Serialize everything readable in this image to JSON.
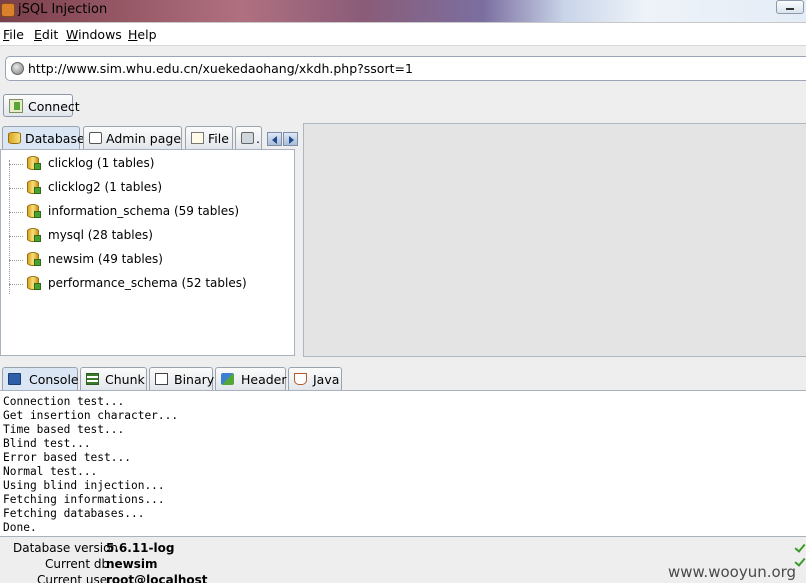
{
  "window": {
    "title": "jSQL Injection"
  },
  "menu": [
    {
      "mnemonic": "F",
      "rest": "ile"
    },
    {
      "mnemonic": "E",
      "rest": "dit"
    },
    {
      "mnemonic": "W",
      "rest": "indows"
    },
    {
      "mnemonic": "H",
      "rest": "elp"
    }
  ],
  "url": {
    "value": "http://www.sim.whu.edu.cn/xuekedaohang/xkdh.php?ssort=1"
  },
  "toolbar": {
    "connect_label": "Connect"
  },
  "left_tabs": [
    {
      "label": "Database",
      "icon": "database-icon",
      "active": true
    },
    {
      "label": "Admin page",
      "icon": "admin-page-icon",
      "active": false
    },
    {
      "label": "File",
      "icon": "file-icon",
      "active": false
    },
    {
      "label": ".",
      "icon": "webshell-icon",
      "active": false
    }
  ],
  "databases": [
    {
      "label": "clicklog (1 tables)"
    },
    {
      "label": "clicklog2 (1 tables)"
    },
    {
      "label": "information_schema (59 tables)"
    },
    {
      "label": "mysql (28 tables)"
    },
    {
      "label": "newsim (49 tables)"
    },
    {
      "label": "performance_schema (52 tables)"
    }
  ],
  "bottom_tabs": [
    {
      "label": "Console",
      "icon": "console-icon",
      "active": true
    },
    {
      "label": "Chunk",
      "icon": "chunk-icon",
      "active": false
    },
    {
      "label": "Binary",
      "icon": "binary-icon",
      "active": false
    },
    {
      "label": "Header",
      "icon": "header-icon",
      "active": false
    },
    {
      "label": "Java",
      "icon": "java-icon",
      "active": false
    }
  ],
  "console": [
    "Connection test...",
    "Get insertion character...",
    "Time based test...",
    "Blind test...",
    "Error based test...",
    "Normal test...",
    "Using blind injection...",
    "Fetching informations...",
    "Fetching databases...",
    "Done."
  ],
  "status": {
    "db_version_label": "Database version",
    "db_version_value": "5.6.11-log",
    "current_db_label": "Current db",
    "current_db_value": "newsim",
    "current_user_label": "Current user",
    "current_user_value": "root@localhost"
  },
  "watermark": "www.wooyun.org"
}
